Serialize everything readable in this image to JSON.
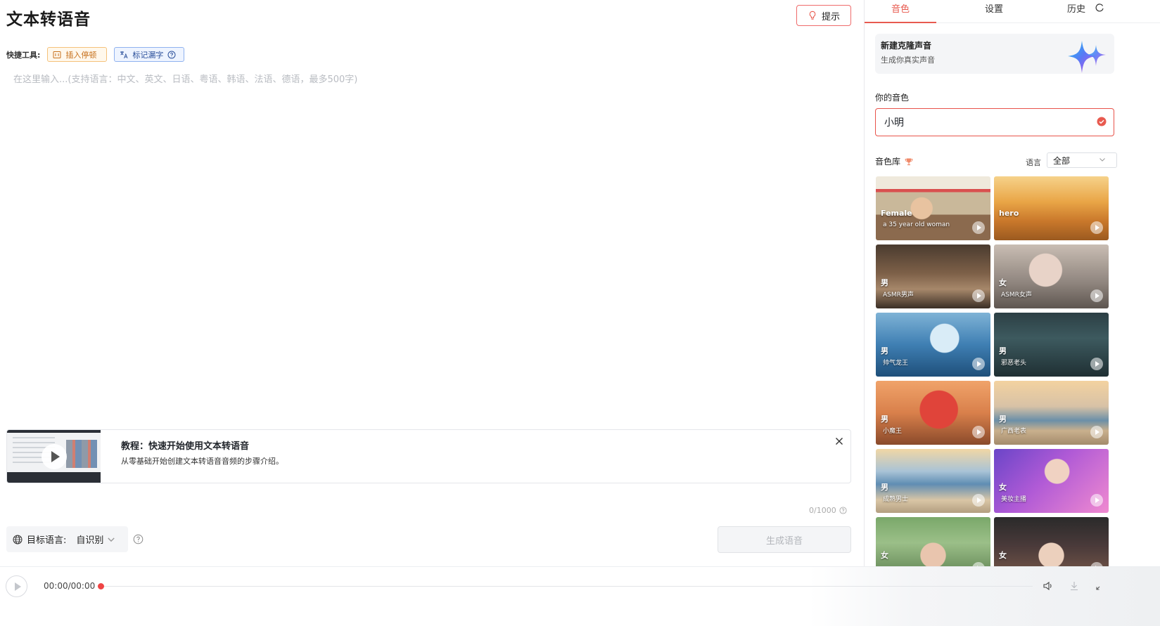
{
  "main": {
    "title": "文本转语音",
    "hint_label": "提示",
    "quick_tools_label": "快捷工具:",
    "insert_pause_label": "插入停顿",
    "mark_missing_label": "标记漏字",
    "input_placeholder": "在这里输入...(支持语言：中文、英文、日语、粤语、韩语、法语、德语，最多500字)",
    "tutorial": {
      "title": "教程：快速开始使用文本转语音",
      "description": "从零基础开始创建文本转语音音频的步骤介绍。"
    },
    "char_count": "0/1000",
    "target_language_label": "目标语言:",
    "target_language_value": "自识别",
    "generate_label": "生成语音"
  },
  "side": {
    "tabs": [
      {
        "label": "音色"
      },
      {
        "label": "设置"
      },
      {
        "label": "历史"
      }
    ],
    "clone": {
      "title": "新建克隆声音",
      "subtitle": "生成你真实声音"
    },
    "your_voice_label": "你的音色",
    "your_voice_value": "小明",
    "library_label": "音色库",
    "language_filter_label": "语言",
    "language_filter_value": "全部",
    "voices": [
      {
        "gender": "Female",
        "name": "a 35 year old woman"
      },
      {
        "gender": "hero",
        "name": ""
      },
      {
        "gender": "男",
        "name": "ASMR男声"
      },
      {
        "gender": "女",
        "name": "ASMR女声"
      },
      {
        "gender": "男",
        "name": "帅气龙王"
      },
      {
        "gender": "男",
        "name": "邪恶老头"
      },
      {
        "gender": "男",
        "name": "小魔王"
      },
      {
        "gender": "男",
        "name": "广西老表"
      },
      {
        "gender": "男",
        "name": "成熟男士"
      },
      {
        "gender": "女",
        "name": "美妆主播"
      },
      {
        "gender": "女",
        "name": ""
      },
      {
        "gender": "女",
        "name": ""
      }
    ]
  },
  "player": {
    "time": "00:00/00:00"
  },
  "colors": {
    "accent": "#e85a4f",
    "tag_orange": "#c7711c",
    "tag_blue": "#2a4f9a"
  }
}
